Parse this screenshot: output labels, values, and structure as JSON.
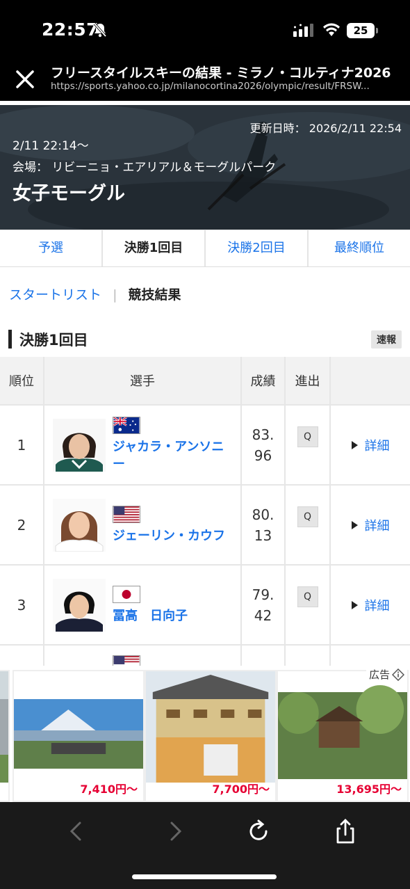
{
  "status_bar": {
    "time": "22:57",
    "battery": "25"
  },
  "browser": {
    "title": "フリースタイルスキーの結果 - ミラノ・コルティナ2026",
    "url": "https://sports.yahoo.co.jp/milanocortina2026/olympic/result/FRSW..."
  },
  "hero": {
    "updated": "更新日時： 2026/2/11 22:54",
    "date": "2/11 22:14〜",
    "venue": "会場： リビーニョ・エアリアル＆モーグルパーク",
    "title": "女子モーグル"
  },
  "tabs": [
    {
      "label": "予選",
      "active": false
    },
    {
      "label": "決勝1回目",
      "active": true
    },
    {
      "label": "決勝2回目",
      "active": false
    },
    {
      "label": "最終順位",
      "active": false
    }
  ],
  "subnav": {
    "link": "スタートリスト",
    "separator": "|",
    "current": "競技結果"
  },
  "section": {
    "title": "決勝1回目",
    "badge": "速報"
  },
  "table": {
    "headers": {
      "rank": "順位",
      "player": "選手",
      "score": "成績",
      "advance": "進出"
    },
    "rows": [
      {
        "rank": "1",
        "name": "ジャカラ・アンソニー",
        "country": "AUS",
        "score": "83.96",
        "advance": "Q",
        "detail": "詳細"
      },
      {
        "rank": "2",
        "name": "ジェーリン・カウフ",
        "country": "USA",
        "score": "80.13",
        "advance": "Q",
        "detail": "詳細"
      },
      {
        "rank": "3",
        "name": "冨高　日向子",
        "country": "JPN",
        "score": "79.42",
        "advance": "Q",
        "detail": "詳細"
      }
    ]
  },
  "ads": {
    "label": "広告",
    "cards": [
      {
        "price": "7,410円〜"
      },
      {
        "price": "7,700円〜"
      },
      {
        "price": "13,695円〜"
      }
    ]
  },
  "colors": {
    "link": "#1a73e8",
    "price": "#e60033",
    "header_bg": "#000000"
  },
  "icons": [
    "close-icon",
    "bell-slash-icon",
    "signal-icon",
    "wifi-icon",
    "info-icon",
    "back-icon",
    "forward-icon",
    "reload-icon",
    "share-icon"
  ]
}
